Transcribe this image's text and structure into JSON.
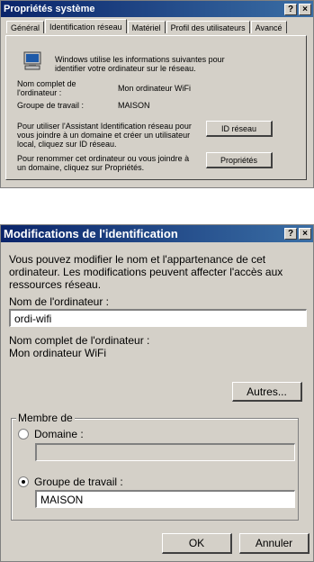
{
  "window1": {
    "title": "Propriétés système",
    "help": "?",
    "close": "×",
    "tabs": [
      "Général",
      "Identification réseau",
      "Matériel",
      "Profil des utilisateurs",
      "Avancé"
    ],
    "intro": "Windows utilise les informations suivantes pour identifier votre ordinateur sur le réseau.",
    "full_name_label": "Nom complet de l'ordinateur :",
    "full_name_value": "Mon ordinateur WiFi",
    "workgroup_label": "Groupe de travail :",
    "workgroup_value": "MAISON",
    "wizard_text": "Pour utiliser l'Assistant Identification réseau pour vous joindre à un domaine et créer un utilisateur local, cliquez sur ID réseau.",
    "id_button": "ID réseau",
    "rename_text": "Pour renommer cet ordinateur ou vous joindre à un domaine, cliquez sur Propriétés.",
    "properties_button": "Propriétés"
  },
  "window2": {
    "title": "Modifications de l'identification",
    "help": "?",
    "close": "×",
    "intro": "Vous pouvez modifier le nom et l'appartenance de cet ordinateur. Les modifications peuvent affecter l'accès aux ressources réseau.",
    "computer_name_label": "Nom de l'ordinateur :",
    "computer_name_value": "ordi-wifi",
    "full_name_label": "Nom complet de l'ordinateur :",
    "full_name_value": "Mon ordinateur WiFi",
    "more_button": "Autres...",
    "member_group": "Membre de",
    "domain_label": "Domaine :",
    "domain_value": "",
    "workgroup_label": "Groupe de travail :",
    "workgroup_value": "MAISON",
    "selected_membership": "workgroup",
    "ok_button": "OK",
    "cancel_button": "Annuler"
  }
}
